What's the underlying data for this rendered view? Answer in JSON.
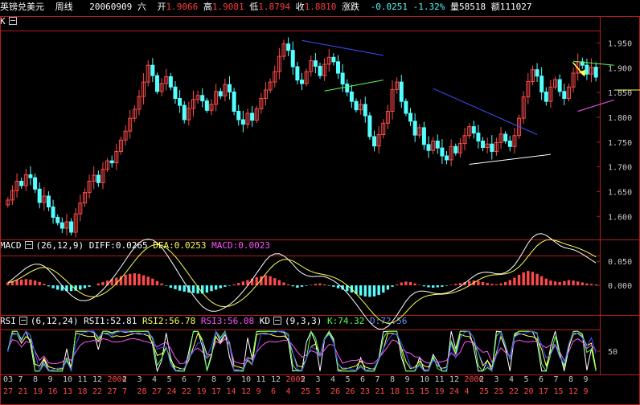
{
  "header": {
    "name": "英镑兑美元",
    "period": "周线",
    "date": "20060909",
    "weekday": "六",
    "open_label": "开",
    "open": "1.9066",
    "high_label": "高",
    "high": "1.9081",
    "low_label": "低",
    "low": "1.8794",
    "close_label": "收",
    "close": "1.8810",
    "change_label": "涨跌",
    "change": "-0.0251",
    "change_pct": "-1.32%",
    "volume_label": "量",
    "volume": "58518",
    "amount_label": "额",
    "amount": "111027"
  },
  "k_panel": {
    "label": "K"
  },
  "macd_panel": {
    "label": "MACD",
    "params": "(26,12,9)",
    "diff_label": "DIFF:",
    "diff": "0.0265",
    "dea_label": "DEA:",
    "dea": "0.0253",
    "macd_label": "MACD:",
    "macd": "0.0023"
  },
  "rsi_panel": {
    "label": "RSI",
    "params": "(6,12,24)",
    "rsi1_label": "RSI1:",
    "rsi1": "52.81",
    "rsi2_label": "RSI2:",
    "rsi2": "56.78",
    "rsi3_label": "RSI3:",
    "rsi3": "56.08",
    "kd_label": "KD",
    "kd_params": "(9,3,3)",
    "k_label": "K:",
    "k": "74.32",
    "d_label": "D:",
    "d": "72.56"
  },
  "colors": {
    "up": "#ff4a4a",
    "down": "#54ffff",
    "border": "#b41e1e",
    "axis_text": "#c8c8c8",
    "white": "#ffffff",
    "yellow": "#ffff54",
    "magenta": "#ff54ff",
    "green": "#54ff54",
    "blue": "#3c50ff"
  },
  "chart_data": [
    {
      "type": "candlestick",
      "title": "英镑兑美元 周线",
      "ylim": [
        1.555,
        1.975
      ],
      "y_ticks": [
        "1.950",
        "1.900",
        "1.850",
        "1.800",
        "1.750",
        "1.700",
        "1.650",
        "1.600"
      ],
      "y_tick_values": [
        1.95,
        1.9,
        1.85,
        1.8,
        1.75,
        1.7,
        1.65,
        1.6
      ],
      "close_series": [
        1.633,
        1.652,
        1.671,
        1.662,
        1.684,
        1.678,
        1.655,
        1.628,
        1.641,
        1.619,
        1.598,
        1.587,
        1.576,
        1.589,
        1.568,
        1.605,
        1.627,
        1.648,
        1.671,
        1.683,
        1.668,
        1.695,
        1.712,
        1.708,
        1.731,
        1.754,
        1.772,
        1.798,
        1.816,
        1.842,
        1.871,
        1.905,
        1.884,
        1.852,
        1.868,
        1.882,
        1.861,
        1.838,
        1.824,
        1.795,
        1.818,
        1.836,
        1.844,
        1.833,
        1.814,
        1.826,
        1.852,
        1.843,
        1.866,
        1.851,
        1.812,
        1.795,
        1.786,
        1.808,
        1.794,
        1.817,
        1.838,
        1.855,
        1.871,
        1.892,
        1.923,
        1.948,
        1.935,
        1.902,
        1.875,
        1.868,
        1.892,
        1.914,
        1.903,
        1.884,
        1.907,
        1.921,
        1.912,
        1.889,
        1.867,
        1.851,
        1.832,
        1.815,
        1.826,
        1.803,
        1.761,
        1.742,
        1.765,
        1.788,
        1.812,
        1.856,
        1.871,
        1.832,
        1.808,
        1.792,
        1.764,
        1.779,
        1.745,
        1.733,
        1.752,
        1.738,
        1.722,
        1.714,
        1.741,
        1.728,
        1.747,
        1.763,
        1.781,
        1.768,
        1.752,
        1.739,
        1.746,
        1.731,
        1.749,
        1.766,
        1.752,
        1.741,
        1.763,
        1.798,
        1.841,
        1.872,
        1.896,
        1.883,
        1.851,
        1.832,
        1.861,
        1.876,
        1.852,
        1.838,
        1.861,
        1.889,
        1.912,
        1.905,
        1.887,
        1.901,
        1.881
      ],
      "trend_lines": [
        {
          "color": "blue",
          "from": [
            65,
            1.955
          ],
          "to": [
            83,
            1.925
          ]
        },
        {
          "color": "green",
          "from": [
            70,
            1.853
          ],
          "to": [
            83,
            1.875
          ]
        },
        {
          "color": "blue",
          "from": [
            94,
            1.858
          ],
          "to": [
            117,
            1.765
          ]
        },
        {
          "color": "white",
          "from": [
            102,
            1.705
          ],
          "to": [
            120,
            1.725
          ]
        },
        {
          "color": "green",
          "from": [
            125,
            1.913
          ],
          "to": [
            134,
            1.905
          ]
        },
        {
          "color": "magenta",
          "from": [
            126,
            1.812
          ],
          "to": [
            134,
            1.835
          ]
        },
        {
          "color": "yellow",
          "from": [
            134,
            1.855
          ],
          "to": [
            145,
            1.855
          ]
        }
      ]
    },
    {
      "type": "macd",
      "title": "MACD (26,12,9)",
      "ylim": [
        -0.06,
        0.062
      ],
      "y_ticks": [
        "0.050",
        "0.000"
      ],
      "y_tick_values": [
        0.05,
        0.0
      ],
      "macd_hist": [
        0.006,
        0.009,
        0.011,
        0.012,
        0.013,
        0.012,
        0.01,
        0.007,
        0.003,
        -0.002,
        -0.006,
        -0.009,
        -0.011,
        -0.012,
        -0.012,
        -0.011,
        -0.009,
        -0.006,
        -0.003,
        0.0,
        0.004,
        0.007,
        0.01,
        0.013,
        0.016,
        0.019,
        0.022,
        0.024,
        0.025,
        0.024,
        0.021,
        0.018,
        0.014,
        0.009,
        0.004,
        -0.001,
        -0.005,
        -0.008,
        -0.011,
        -0.013,
        -0.015,
        -0.016,
        -0.017,
        -0.017,
        -0.015,
        -0.012,
        -0.009,
        -0.006,
        -0.003,
        -0.001,
        0.002,
        0.005,
        0.008,
        0.011,
        0.014,
        0.017,
        0.019,
        0.021,
        0.019,
        0.015,
        0.011,
        0.006,
        0.002,
        -0.002,
        -0.005,
        -0.003,
        -0.001,
        0.001,
        0.003,
        0.004,
        0.002,
        -0.001,
        -0.003,
        -0.006,
        -0.009,
        -0.012,
        -0.015,
        -0.018,
        -0.021,
        -0.023,
        -0.024,
        -0.023,
        -0.02,
        -0.015,
        -0.009,
        -0.003,
        0.002,
        0.006,
        0.008,
        0.007,
        0.004,
        0.001,
        -0.002,
        -0.004,
        -0.005,
        -0.004,
        -0.003,
        -0.001,
        0.001,
        0.003,
        0.005,
        0.007,
        0.009,
        0.01,
        0.009,
        0.007,
        0.005,
        0.003,
        0.002,
        0.004,
        0.007,
        0.011,
        0.016,
        0.022,
        0.027,
        0.03,
        0.028,
        0.024,
        0.019,
        0.014,
        0.01,
        0.008,
        0.007,
        0.009,
        0.011,
        0.01,
        0.008,
        0.006,
        0.004,
        0.003,
        0.002
      ],
      "series": [
        {
          "name": "DIFF",
          "color": "white"
        },
        {
          "name": "DEA",
          "color": "yellow"
        }
      ]
    },
    {
      "type": "line",
      "title": "RSI (6,12,24) / KD (9,3,3)",
      "ylim": [
        0,
        100
      ],
      "y_ticks": [
        "50"
      ],
      "y_tick_values": [
        50
      ],
      "series": [
        {
          "name": "RSI1",
          "color": "white"
        },
        {
          "name": "RSI2",
          "color": "yellow"
        },
        {
          "name": "RSI3",
          "color": "magenta"
        },
        {
          "name": "K",
          "color": "green"
        },
        {
          "name": "D",
          "color": "blue"
        }
      ],
      "x_month_labels": [
        "03",
        "7",
        "8",
        "9",
        "10",
        "11",
        "12",
        "2004",
        "2",
        "3",
        "4",
        "5",
        "6",
        "7",
        "8",
        "9",
        "10",
        "11",
        "12",
        "2005",
        "2",
        "3",
        "4",
        "5",
        "6",
        "7",
        "8",
        "9",
        "10",
        "11",
        "12",
        "2006",
        "2",
        "3",
        "4",
        "5",
        "6",
        "7",
        "8",
        "9"
      ],
      "x_day_labels": [
        "27",
        "21",
        "19",
        "16",
        "13",
        "18",
        "22",
        "27",
        "7",
        "28",
        "27",
        "24",
        "22",
        "19",
        "17",
        "14",
        "12",
        "9",
        "6",
        "4",
        "25",
        "5",
        "26",
        "26",
        "23",
        "21",
        "18",
        "15",
        "15",
        "19",
        "24",
        "4",
        "25",
        "25",
        "22",
        "20",
        "17",
        "15",
        "12",
        "9"
      ]
    }
  ]
}
